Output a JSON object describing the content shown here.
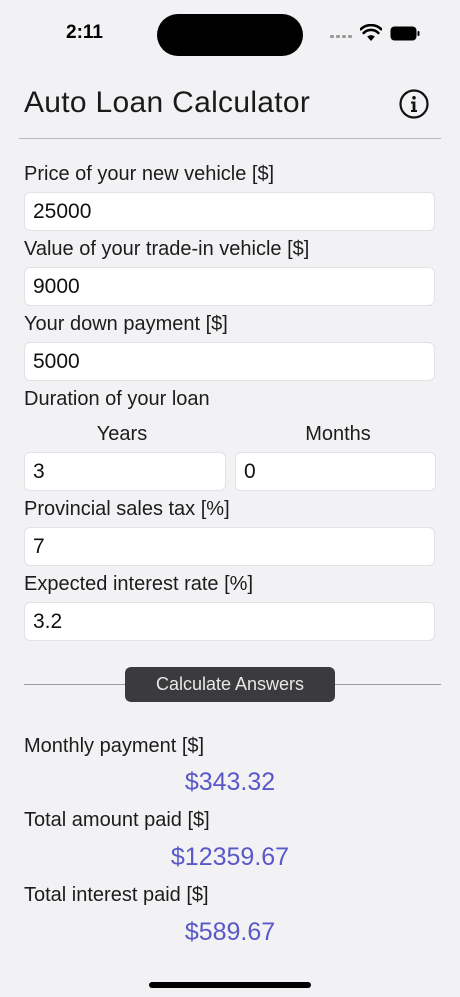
{
  "status_bar": {
    "time": "2:11"
  },
  "header": {
    "title": "Auto Loan Calculator"
  },
  "form": {
    "price": {
      "label": "Price of your new vehicle [$]",
      "value": "25000"
    },
    "trade_in": {
      "label": "Value of your trade-in vehicle [$]",
      "value": "9000"
    },
    "down_payment": {
      "label": "Your down payment [$]",
      "value": "5000"
    },
    "duration": {
      "label": "Duration of your loan",
      "years_label": "Years",
      "years_value": "3",
      "months_label": "Months",
      "months_value": "0"
    },
    "sales_tax": {
      "label": "Provincial sales tax [%]",
      "value": "7"
    },
    "interest_rate": {
      "label": "Expected interest rate [%]",
      "value": "3.2"
    }
  },
  "calculate_button": "Calculate Answers",
  "results": {
    "monthly": {
      "label": "Monthly payment [$]",
      "value": "$343.32"
    },
    "total_paid": {
      "label": "Total amount paid [$]",
      "value": "$12359.67"
    },
    "total_interest": {
      "label": "Total interest paid [$]",
      "value": "$589.67"
    }
  },
  "colors": {
    "result_text": "#5a58c8",
    "button_bg": "#3b3b3d",
    "background": "#f2f2f4"
  }
}
